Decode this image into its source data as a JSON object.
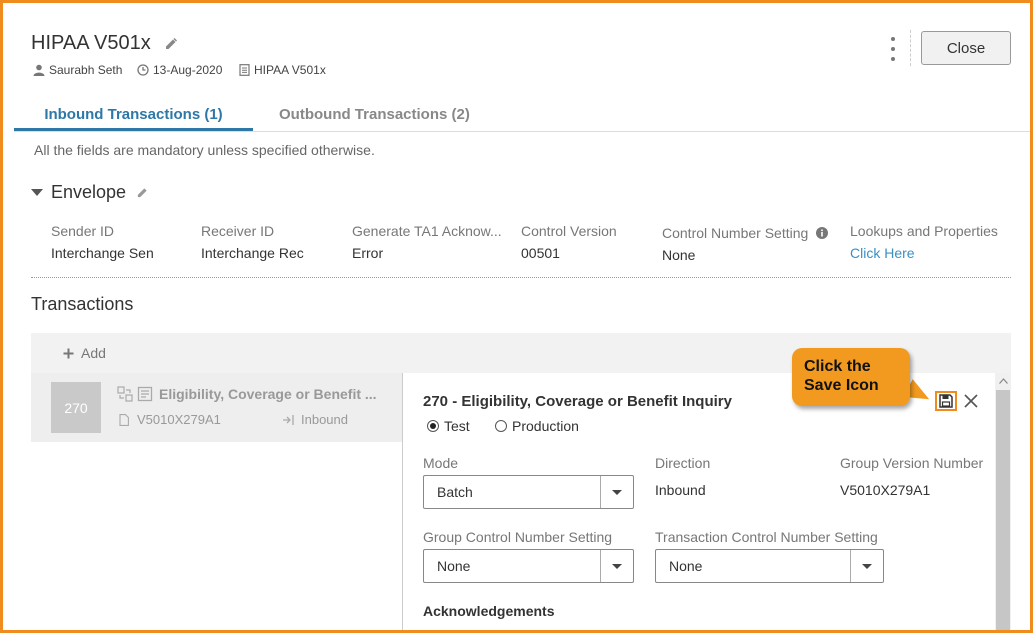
{
  "header": {
    "title": "HIPAA V501x",
    "author": "Saurabh Seth",
    "date": "13-Aug-2020",
    "doc": "HIPAA V501x",
    "close_label": "Close"
  },
  "tabs": [
    {
      "label": "Inbound Transactions (1)",
      "active": true
    },
    {
      "label": "Outbound Transactions (2)",
      "active": false
    }
  ],
  "hint": "All the fields are mandatory unless specified otherwise.",
  "envelope": {
    "title": "Envelope",
    "fields": [
      {
        "label": "Sender ID",
        "value": "Interchange Sen"
      },
      {
        "label": "Receiver ID",
        "value": "Interchange Rec"
      },
      {
        "label": "Generate TA1 Acknow...",
        "value": "Error"
      },
      {
        "label": "Control Version",
        "value": "00501"
      },
      {
        "label": "Control Number Setting",
        "value": "None"
      },
      {
        "label": "Lookups and Properties",
        "value": "Click Here"
      }
    ]
  },
  "transactions": {
    "title": "Transactions",
    "add_label": "Add",
    "item": {
      "code": "270",
      "title": "Eligibility, Coverage or Benefit ...",
      "version": "V5010X279A1",
      "direction": "Inbound"
    }
  },
  "panel": {
    "title": "270 - Eligibility, Coverage or Benefit Inquiry",
    "radio_test": "Test",
    "radio_production": "Production",
    "selected_mode": "Test",
    "mode_label": "Mode",
    "mode_value": "Batch",
    "direction_label": "Direction",
    "direction_value": "Inbound",
    "gvn_label": "Group Version Number",
    "gvn_value": "V5010X279A1",
    "gcn_label": "Group Control Number Setting",
    "gcn_value": "None",
    "tcn_label": "Transaction Control Number Setting",
    "tcn_value": "None",
    "ack_label": "Acknowledgements"
  },
  "callout": {
    "line1": "Click the",
    "line2": "Save Icon"
  },
  "colors": {
    "accent": "#2d78a6",
    "highlight": "#f08c1e",
    "link": "#3b8fc4"
  }
}
